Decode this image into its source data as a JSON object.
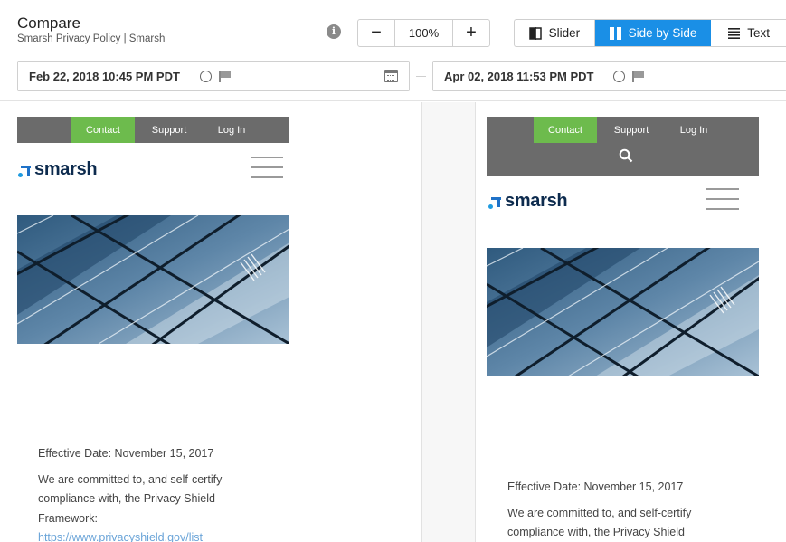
{
  "header": {
    "title": "Compare",
    "subtitle": "Smarsh Privacy Policy | Smarsh",
    "info_icon": "info-icon"
  },
  "zoom": {
    "minus": "−",
    "value": "100%",
    "plus": "+"
  },
  "modes": [
    {
      "label": "Slider",
      "icon": "slider-icon",
      "selected": false
    },
    {
      "label": "Side by Side",
      "icon": "columns-icon",
      "selected": true
    },
    {
      "label": "Text",
      "icon": "text-lines-icon",
      "selected": false
    }
  ],
  "dates": {
    "left": "Feb 22, 2018 10:45 PM PDT",
    "right": "Apr 02, 2018 11:53 PM PDT"
  },
  "left_page": {
    "nav": [
      "Contact",
      "Support",
      "Log In"
    ],
    "logo": "smarsh",
    "effective": "Effective Date: November 15, 2017",
    "para": [
      "We are committed to, and self-certify",
      "compliance with, the Privacy Shield",
      "Framework:"
    ],
    "link": "https://www.privacyshield.gov/list"
  },
  "right_page": {
    "nav": [
      "Contact",
      "Support",
      "Log In"
    ],
    "logo": "smarsh",
    "effective": "Effective Date: November 15, 2017",
    "para": [
      "We are committed to, and self-certify",
      "compliance with, the Privacy Shield"
    ]
  },
  "colors": {
    "accent": "#1a8fe6",
    "nav_bg": "#6b6b6b",
    "contact_green": "#6dbb4d",
    "logo_navy": "#0d2b4e",
    "logo_blue": "#1f72c8"
  }
}
